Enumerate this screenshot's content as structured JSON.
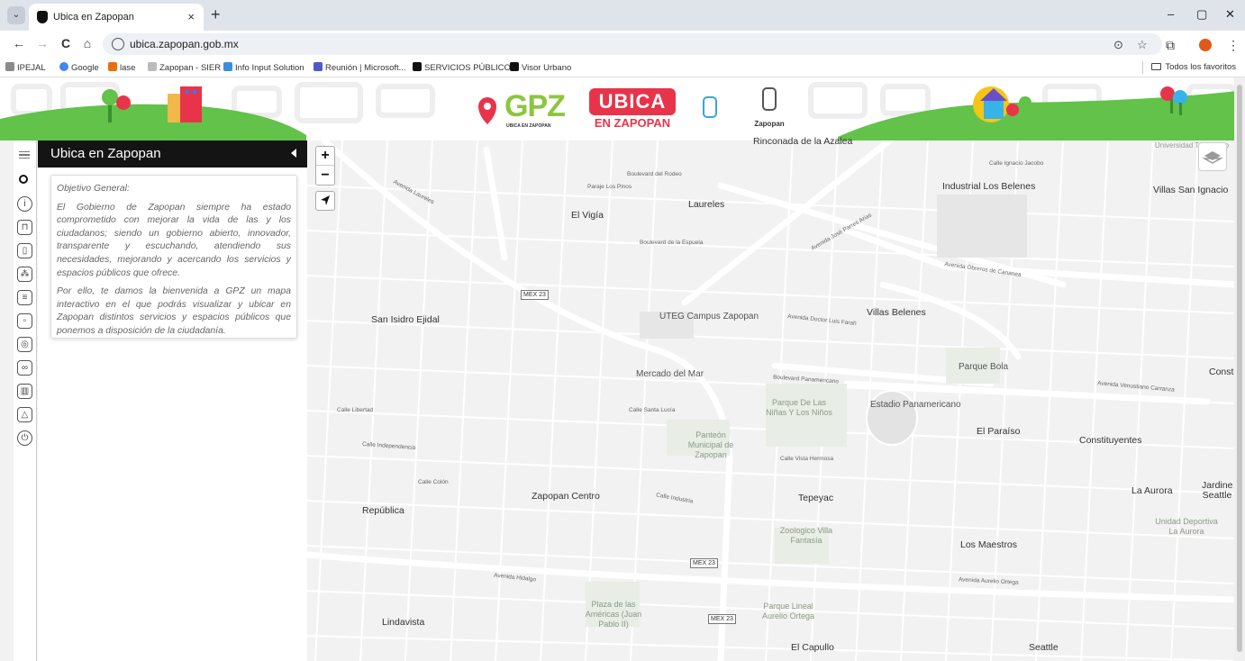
{
  "browser": {
    "tab": {
      "title": "Ubica en Zapopan",
      "close": "×"
    },
    "new_tab": "+",
    "window_controls": {
      "minimize": "–",
      "restore": "▢",
      "close": "✕"
    },
    "nav": {
      "back": "←",
      "forward": "→",
      "reload": "C",
      "home": "⌂"
    },
    "url": "ubica.zapopan.gob.mx",
    "bookmarks": [
      {
        "label": "IPEJAL",
        "color": "#8a8a8a"
      },
      {
        "label": "Google",
        "color": "#4285f4"
      },
      {
        "label": "lase",
        "color": "#e8710a"
      },
      {
        "label": "Zapopan - SIER",
        "color": "#bbbbbb"
      },
      {
        "label": "Info Input Solution",
        "color": "#3c8dde"
      },
      {
        "label": "Reunión | Microsoft...",
        "color": "#5059c9"
      },
      {
        "label": "SERVICIOS PÚBLICOS",
        "color": "#111111"
      },
      {
        "label": "Visor Urbano",
        "color": "#111111"
      }
    ],
    "all_bookmarks": "Todos los favoritos"
  },
  "header": {
    "gpz_logo": "GPZ",
    "gpz_tagline": "UBICA EN ZAPOPAN",
    "ubica_logo_top": "UBICA",
    "ubica_logo_bottom": "EN ZAPOPAN",
    "zapopan_logo": "Zapopan"
  },
  "panel": {
    "title": "Ubica en Zapopan",
    "heading": "Objetivo General:",
    "paragraph1": "El Gobierno de Zapopan siempre ha estado comprometido con mejorar la vida de las y los ciudadanos; siendo un gobierno abierto, innovador, transparente y escuchando, atendiendo sus necesidades, mejorando y acercando los servicios y espacios públicos que ofrece.",
    "paragraph2": "Por ello, te damos la bienvenida a GPZ un mapa interactivo en el que podrás visualizar y ubicar en Zapopan distintos servicios y espacios públicos que ponemos a disposición de la ciudadanía."
  },
  "map_controls": {
    "zoom_in": "+",
    "zoom_out": "−"
  },
  "map_labels": {
    "neighborhoods": [
      "Rinconada de la Azalea",
      "Industrial Los Belenes",
      "Villas San Ignacio",
      "El Vigía",
      "Laureles",
      "San Isidro Ejidal",
      "UTEG Campus Zapopan",
      "Villas Belenes",
      "Mercado del Mar",
      "Parque Bola",
      "Estadio Panamericano",
      "El Paraíso",
      "Constituyentes",
      "Zapopan Centro",
      "Tepeyac",
      "La Aurora",
      "República",
      "Los Maestros",
      "Lindavista",
      "El Capullo",
      "Seattle",
      "Universidad TecMilenio"
    ],
    "parks": [
      "Parque De Las Niñas Y Los Niños",
      "Panteón Municipal de Zapopan",
      "Zoologico Villa Fantasía",
      "Plaza de las Américas (Juan Pablo II)",
      "Parque Lineal Aurelio Ortega",
      "Unidad Deportiva La Aurora"
    ],
    "streets": [
      "Boulevard del Rodeo",
      "Avenida Laureles",
      "Avenida José Parres Arias",
      "Avenida Obreros de Cananea",
      "Avenida Doctor Luis Farah",
      "Boulevard Panamericano",
      "Avenida Venustiano Carranza",
      "Avenida Hidalgo",
      "Avenida Aurelio Ortega",
      "Calle Independencia",
      "Calle Libertad",
      "Calle Santa Lucía",
      "Calle Colón",
      "Calle Industria",
      "Calle Vista Hermosa",
      "Boulevard de la Espuela",
      "Paraje Los Pinos",
      "Calle Ignacio Jacobo"
    ],
    "shield": "MEX 23",
    "edge_label": "Consti",
    "edge_label2": "Jardine Seattle"
  },
  "colors": {
    "grass": "#62c24a",
    "ubica_red": "#e8344a",
    "gpz_green": "#8cc63e",
    "panel_header": "#141414"
  }
}
